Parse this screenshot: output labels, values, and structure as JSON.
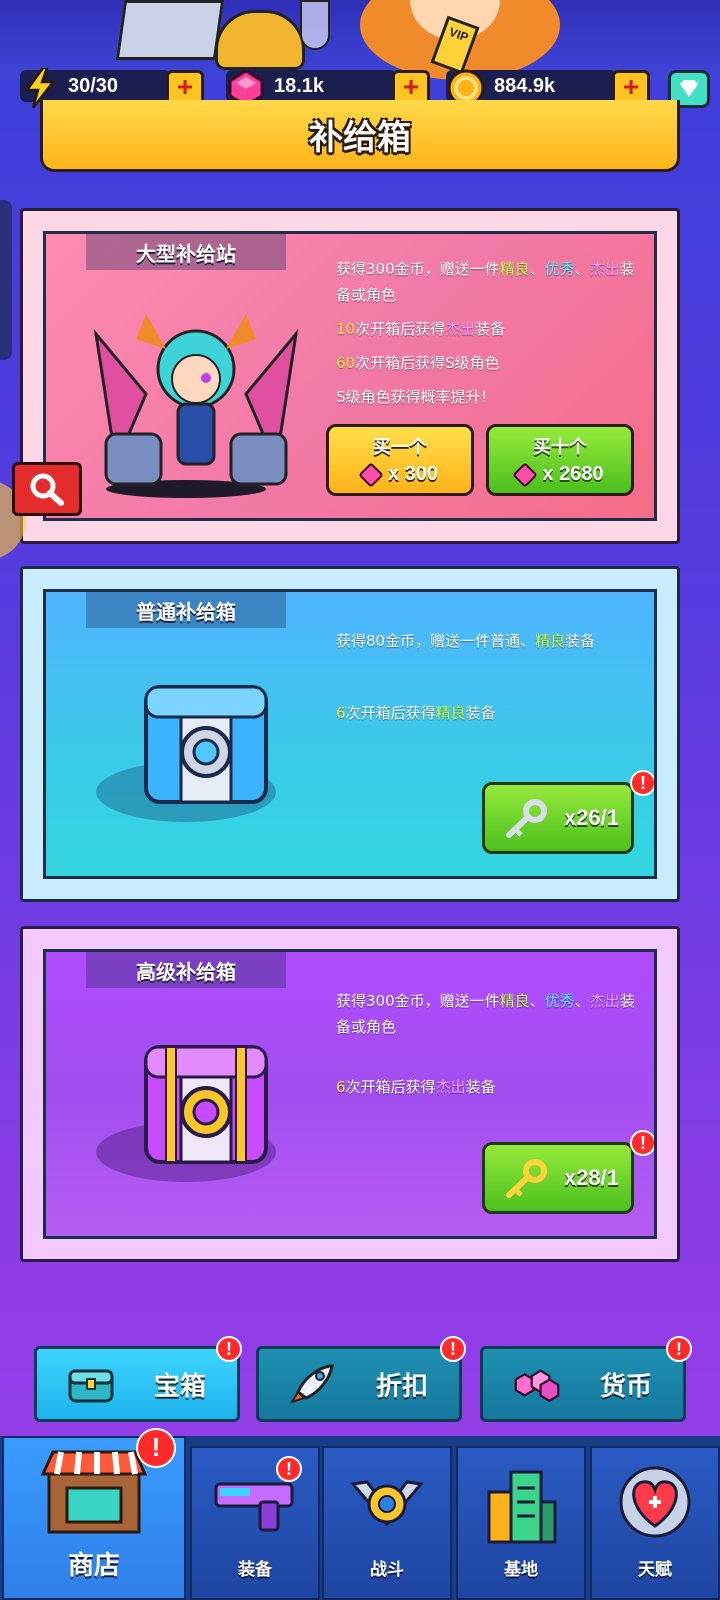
{
  "resources": {
    "energy": "30/30",
    "gems": "18.1k",
    "coins": "884.9k",
    "vip_label": "VIP"
  },
  "page_title": "补给箱",
  "cards": {
    "large": {
      "label": "大型补给站",
      "desc_line1_pre": "获得300金币，赠送一件",
      "desc_line1_q1": "精良",
      "desc_line1_sep": "、",
      "desc_line1_q2": "优秀",
      "desc_line1_sep2": "、",
      "desc_line1_q3": "杰出",
      "desc_line1_post": "装备或角色",
      "desc_line2_num": "10",
      "desc_line2_pre": "次开箱后获得",
      "desc_line2_q": "杰出",
      "desc_line2_post": "装备",
      "desc_line3_num": "60",
      "desc_line3_text": "次开箱后获得S级角色",
      "desc_line4": "S级角色获得概率提升！",
      "buy_one_label": "买一个",
      "buy_one_cost": "x 300",
      "buy_ten_label": "买十个",
      "buy_ten_cost": "x 2680"
    },
    "normal": {
      "label": "普通补给箱",
      "desc_line1_pre": "获得80金币，赠送一件普通、",
      "desc_line1_q": "精良",
      "desc_line1_post": "装备",
      "desc_line2_num": "6",
      "desc_line2_pre": "次开箱后获得",
      "desc_line2_q": "精良",
      "desc_line2_post": "装备",
      "key_count": "x26/1"
    },
    "advanced": {
      "label": "高级补给箱",
      "desc_line1_pre": "获得300金币，赠送一件",
      "desc_line1_q1": "精良",
      "desc_line1_sep": "、",
      "desc_line1_q2": "优秀",
      "desc_line1_sep2": "、",
      "desc_line1_q3": "杰出",
      "desc_line1_post": "装备或角色",
      "desc_line2_num": "6",
      "desc_line2_pre": "次开箱后获得",
      "desc_line2_q": "杰出",
      "desc_line2_post": "装备",
      "key_count": "x28/1"
    }
  },
  "shop_tabs": [
    {
      "label": "宝箱",
      "icon": "chest-icon",
      "alert": "!"
    },
    {
      "label": "折扣",
      "icon": "rocket-icon",
      "alert": "!"
    },
    {
      "label": "货币",
      "icon": "gems-icon",
      "alert": "!"
    }
  ],
  "bottom_nav": [
    {
      "label": "商店",
      "icon": "shop-icon",
      "alert": "!"
    },
    {
      "label": "装备",
      "icon": "gun-icon",
      "alert": "!"
    },
    {
      "label": "战斗",
      "icon": "battle-icon"
    },
    {
      "label": "基地",
      "icon": "base-icon"
    },
    {
      "label": "天赋",
      "icon": "talent-icon"
    }
  ],
  "alert_mark": "!",
  "colors": {
    "quality_green": "#c8ff4a",
    "quality_cyan": "#5ae6ff",
    "quality_purple": "#e79cff",
    "number_yellow": "#ffe34a",
    "button_green": "#4cbf1e",
    "button_yellow": "#ffb21a"
  }
}
